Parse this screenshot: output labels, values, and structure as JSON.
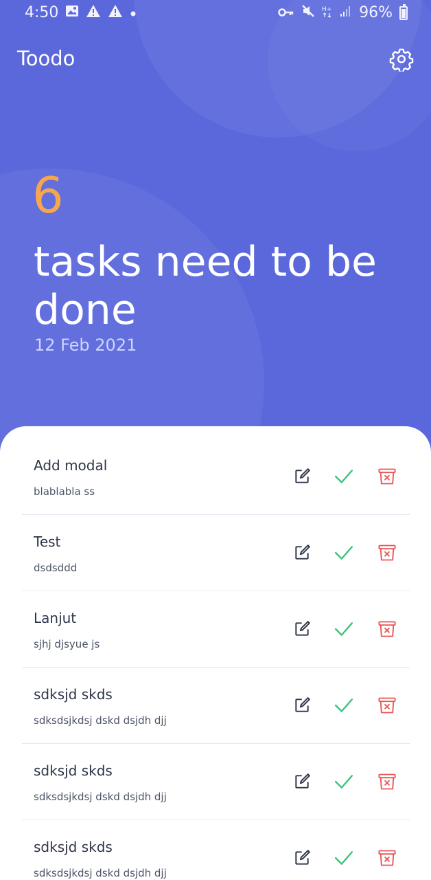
{
  "status_bar": {
    "time": "4:50",
    "battery": "96%",
    "icons": [
      "image-icon",
      "warning-icon",
      "warning-icon",
      "dot-icon",
      "key-icon",
      "mute-icon",
      "hplus-icon",
      "signal-icon",
      "battery-icon"
    ]
  },
  "app_bar": {
    "title": "Toodo",
    "settings_icon": "gear-icon"
  },
  "hero": {
    "count": "6",
    "headline": "tasks need to be done",
    "date": "12 Feb 2021"
  },
  "colors": {
    "background": "#5a68dc",
    "count": "#f7a64d",
    "edit": "#2f3548",
    "done": "#3cc27a",
    "delete": "#ea5454"
  },
  "tasks": [
    {
      "title": "Add modal",
      "desc": "blablabla ss"
    },
    {
      "title": "Test",
      "desc": "dsdsddd"
    },
    {
      "title": "Lanjut",
      "desc": "sjhj djsyue js"
    },
    {
      "title": "sdksjd skds",
      "desc": "sdksdsjkdsj dskd dsjdh djj"
    },
    {
      "title": "sdksjd skds",
      "desc": "sdksdsjkdsj dskd dsjdh djj"
    },
    {
      "title": "sdksjd skds",
      "desc": "sdksdsjkdsj dskd dsjdh djj"
    }
  ]
}
